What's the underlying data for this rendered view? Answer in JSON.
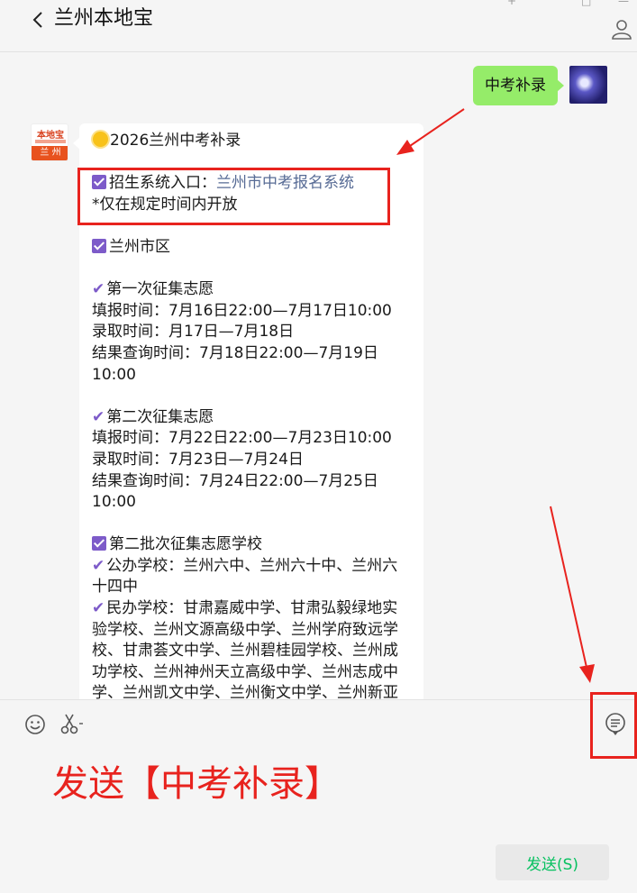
{
  "header": {
    "title": "兰州本地宝",
    "window_controls": [
      "+",
      "□",
      "—"
    ]
  },
  "chat": {
    "user_message": "中考补录",
    "bot_avatar": {
      "top": "本地宝",
      "bottom": "兰 州"
    },
    "bot_message": {
      "heading": "2026兰州中考补录",
      "entry_label": "招生系统入口：",
      "entry_link": "兰州市中考报名系统",
      "entry_note": "*仅在规定时间内开放",
      "district": "兰州市区",
      "round1": {
        "title": "第一次征集志愿",
        "fill": "填报时间：7月16日22:00—7月17日10:00",
        "admit": "录取时间：月17日—7月18日",
        "query_a": "结果查询时间：7月18日22:00—7月19日",
        "query_b": "10:00"
      },
      "round2": {
        "title": "第二次征集志愿",
        "fill": "填报时间：7月22日22:00—7月23日10:00",
        "admit": "录取时间：7月23日—7月24日",
        "query_a": "结果查询时间：7月24日22:00—7月25日",
        "query_b": "10:00"
      },
      "schools": {
        "title": "第二批次征集志愿学校",
        "public_a": "公办学校：兰州六中、兰州六十中、兰州六",
        "public_b": "十四中",
        "private_lines": [
          "民办学校：甘肃嘉威中学、甘肃弘毅绿地实",
          "验学校、兰州文源高级中学、兰州学府致远学",
          "校、甘肃荟文中学、兰州碧桂园学校、兰州成",
          "功学校、兰州神州天立高级中学、兰州志成中",
          "学、兰州凯文中学、兰州衡文中学、兰州新亚"
        ]
      }
    }
  },
  "input": {
    "instruction": "发送【中考补录】",
    "send_label": "发送(S)"
  },
  "colors": {
    "user_bubble": "#95ec69",
    "link": "#576b95",
    "highlight": "#e8231e",
    "send_text": "#07c160",
    "check": "#7d5bc9"
  }
}
